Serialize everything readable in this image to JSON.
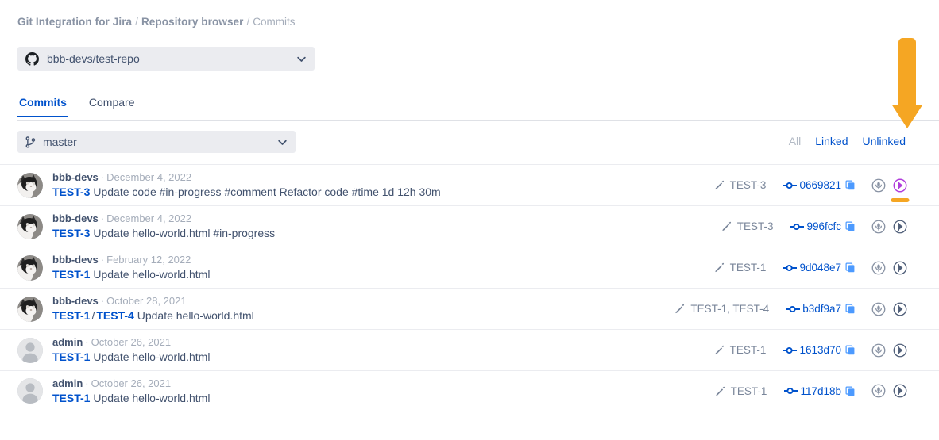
{
  "breadcrumb": {
    "items": [
      "Git Integration for Jira",
      "Repository browser",
      "Commits"
    ],
    "separator": "/"
  },
  "repo_selector": {
    "label": "bbb-devs/test-repo",
    "icon": "github-icon",
    "caret_icon": "chevron-down-icon"
  },
  "tabs": [
    {
      "label": "Commits",
      "active": true
    },
    {
      "label": "Compare",
      "active": false
    }
  ],
  "branch_selector": {
    "label": "master",
    "icon": "branch-icon",
    "caret_icon": "chevron-down-icon"
  },
  "filters": [
    {
      "label": "All",
      "active": true
    },
    {
      "label": "Linked",
      "active": false
    },
    {
      "label": "Unlinked",
      "active": false
    }
  ],
  "colors": {
    "link": "#0052cc",
    "muted": "#7a869a",
    "annotation": "#f5a623",
    "highlight": "#b03cdb",
    "row_border": "#ebecf0",
    "field_bg": "#ebecf0"
  },
  "annotation": {
    "arrow_icon": "down-arrow-annotation",
    "arrow_color": "#f5a623",
    "points_to": "Unlinked",
    "underline_color": "#f5a623",
    "underline_target": "commit-diff-icon"
  },
  "commits": [
    {
      "avatar": "cat-photo-avatar",
      "author": "bbb-devs",
      "date": "December 4, 2022",
      "keys": [
        "TEST-3"
      ],
      "message": "Update code #in-progress #comment Refactor code #time 1d 12h 30m",
      "issues_label": "TEST-3",
      "hash": "0669821",
      "highlighted_action": true
    },
    {
      "avatar": "cat-photo-avatar",
      "author": "bbb-devs",
      "date": "December 4, 2022",
      "keys": [
        "TEST-3"
      ],
      "message": "Update hello-world.html #in-progress",
      "issues_label": "TEST-3",
      "hash": "996fcfc",
      "highlighted_action": false
    },
    {
      "avatar": "cat-photo-avatar",
      "author": "bbb-devs",
      "date": "February 12, 2022",
      "keys": [
        "TEST-1"
      ],
      "message": "Update hello-world.html",
      "issues_label": "TEST-1",
      "hash": "9d048e7",
      "highlighted_action": false
    },
    {
      "avatar": "cat-photo-avatar",
      "author": "bbb-devs",
      "date": "October 28, 2021",
      "keys": [
        "TEST-1",
        "TEST-4"
      ],
      "message": "Update hello-world.html",
      "issues_label": "TEST-1, TEST-4",
      "hash": "b3df9a7",
      "highlighted_action": false
    },
    {
      "avatar": "default-person-avatar",
      "author": "admin",
      "date": "October 26, 2021",
      "keys": [
        "TEST-1"
      ],
      "message": "Update hello-world.html",
      "issues_label": "TEST-1",
      "hash": "1613d70",
      "highlighted_action": false
    },
    {
      "avatar": "default-person-avatar",
      "author": "admin",
      "date": "October 26, 2021",
      "keys": [
        "TEST-1"
      ],
      "message": "Update hello-world.html",
      "issues_label": "TEST-1",
      "hash": "117d18b",
      "highlighted_action": false
    }
  ],
  "row_icons": {
    "pencil": "pencil-icon",
    "node": "commit-node-icon",
    "copy": "copy-icon",
    "action1": "jira-issue-icon",
    "action2": "commit-diff-icon"
  }
}
